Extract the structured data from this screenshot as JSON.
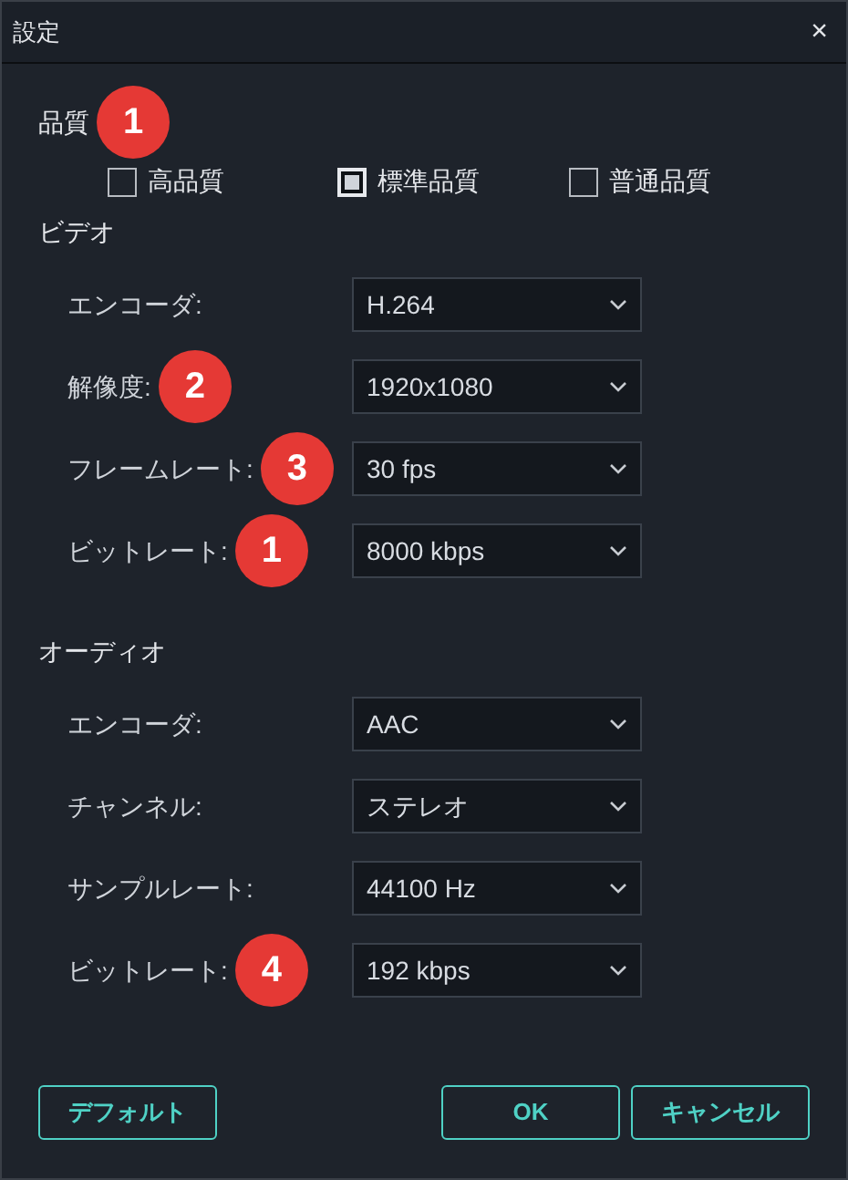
{
  "window": {
    "title": "設定",
    "close": "×"
  },
  "quality": {
    "label": "品質",
    "badge": "1",
    "options": [
      {
        "label": "高品質",
        "selected": false
      },
      {
        "label": "標準品質",
        "selected": true
      },
      {
        "label": "普通品質",
        "selected": false
      }
    ]
  },
  "video": {
    "label": "ビデオ",
    "rows": [
      {
        "label": "エンコーダ:",
        "value": "H.264"
      },
      {
        "label": "解像度:",
        "value": "1920x1080",
        "badge": "2"
      },
      {
        "label": "フレームレート:",
        "value": "30 fps",
        "badge": "3"
      },
      {
        "label": "ビットレート:",
        "value": "8000 kbps",
        "badge": "1"
      }
    ]
  },
  "audio": {
    "label": "オーディオ",
    "rows": [
      {
        "label": "エンコーダ:",
        "value": "AAC"
      },
      {
        "label": "チャンネル:",
        "value": "ステレオ"
      },
      {
        "label": "サンプルレート:",
        "value": "44100 Hz"
      },
      {
        "label": "ビットレート:",
        "value": "192 kbps",
        "badge": "4"
      }
    ]
  },
  "buttons": {
    "default": "デフォルト",
    "ok": "OK",
    "cancel": "キャンセル"
  }
}
